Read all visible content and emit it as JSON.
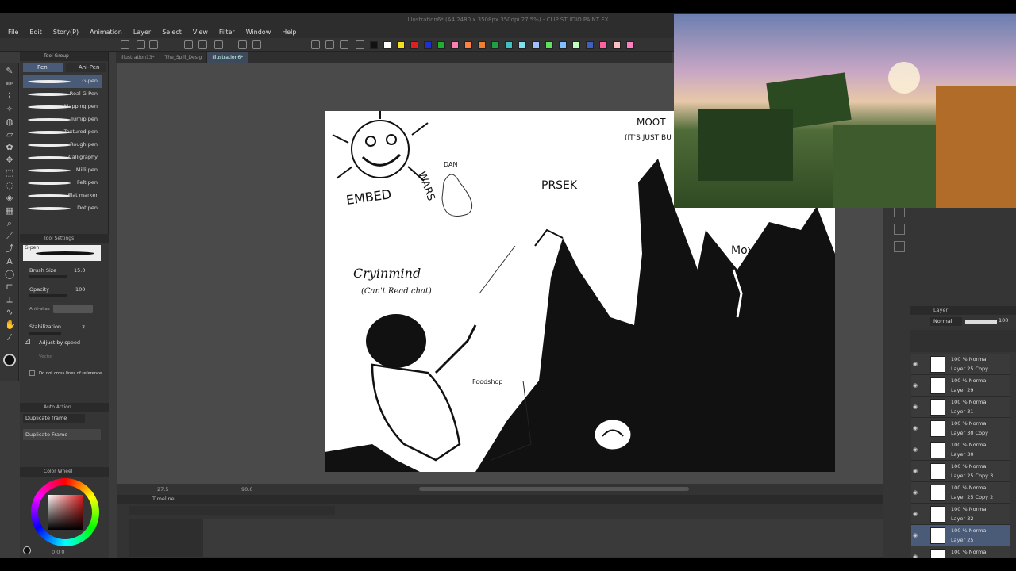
{
  "window": {
    "title": "Illustration6* (A4 2480 x 3508px 350dpi 27.5%) - CLIP STUDIO PAINT EX"
  },
  "menu": [
    "File",
    "Edit",
    "Story(P)",
    "Animation",
    "Layer",
    "Select",
    "View",
    "Filter",
    "Window",
    "Help"
  ],
  "doc_tabs": [
    {
      "label": "Illustration13*"
    },
    {
      "label": "The_Spill_Desig"
    },
    {
      "label": "Illustration6*"
    }
  ],
  "palette_colors": [
    "#111111",
    "#ffffff",
    "#f5e020",
    "#e02020",
    "#2030d0",
    "#20b030",
    "#ff80b0",
    "#ff8040",
    "#f08030",
    "#20a040",
    "#40c0c0",
    "#80e0f0",
    "#a0c0ff",
    "#60e060",
    "#80c0ff",
    "#c0ffc0",
    "#4060c0",
    "#ff60a0",
    "#ffc0c0",
    "#ff80c0"
  ],
  "subtool": {
    "group_title": "Tool Group",
    "tabs": [
      "Pen",
      "Ani-Pen"
    ],
    "pens": [
      "G-pen",
      "Real G-Pen",
      "Mapping pen",
      "Turnip pen",
      "Textured pen",
      "Rough pen",
      "Calligraphy",
      "Milli pen",
      "Felt pen",
      "Flat marker",
      "Dot pen"
    ]
  },
  "tool_settings": {
    "title": "Tool Settings",
    "current": "G-pen",
    "brush_size_label": "Brush Size",
    "brush_size": "15.0",
    "opacity_label": "Opacity",
    "opacity": "100",
    "antialias_label": "Anti-alias",
    "stabilization_label": "Stabilization",
    "stabilization": "7",
    "adjust_label": "Adjust by speed",
    "vector_label": "Vector",
    "no_cross_label": "Do not cross lines of reference"
  },
  "auto_action": {
    "title": "Auto Action",
    "selected": "Duplicate frame",
    "item": "Duplicate Frame"
  },
  "color_wheel": {
    "title": "Color Wheel",
    "values": "0  0  0"
  },
  "status": {
    "zoom": "27.5",
    "angle": "90.0"
  },
  "timeline": {
    "title": "Timeline"
  },
  "layer_panel": {
    "title": "Layer",
    "blend_mode": "Normal",
    "opacity": "100",
    "layers": [
      {
        "blend": "100 % Normal",
        "name": "Layer 25 Copy"
      },
      {
        "blend": "100 % Normal",
        "name": "Layer 29"
      },
      {
        "blend": "100 % Normal",
        "name": "Layer 31"
      },
      {
        "blend": "100 % Normal",
        "name": "Layer 30 Copy"
      },
      {
        "blend": "100 % Normal",
        "name": "Layer 30"
      },
      {
        "blend": "100 % Normal",
        "name": "Layer 25 Copy 3"
      },
      {
        "blend": "100 % Normal",
        "name": "Layer 25 Copy 2"
      },
      {
        "blend": "100 % Normal",
        "name": "Layer 32"
      },
      {
        "blend": "100 % Normal",
        "name": "Layer 25"
      },
      {
        "blend": "100 % Normal",
        "name": ""
      }
    ]
  },
  "artwork": {
    "embed": "EMBED",
    "wars": "WARS",
    "dan": "DAN",
    "prsek": "PRSEK",
    "moot": "MOOT",
    "moot_sub": "(IT'S JUST BU",
    "mox": "Mox",
    "cryingmind": "Cryinmind",
    "cryingmind_sub": "(Can't Read chat)",
    "foodshop": "Foodshop"
  }
}
